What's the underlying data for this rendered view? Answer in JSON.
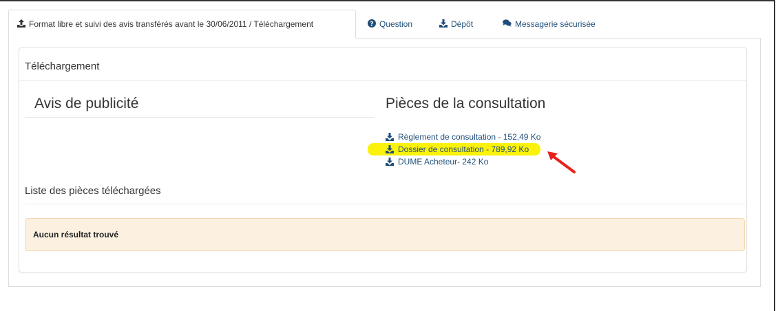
{
  "tabs": [
    {
      "label": "Format libre et suivi des avis transférés avant le 30/06/2011 / Téléchargement",
      "icon": "upload-icon",
      "active": true
    },
    {
      "label": "Question",
      "icon": "question-circle-icon",
      "active": false
    },
    {
      "label": "Dépôt",
      "icon": "download-icon",
      "active": false
    },
    {
      "label": "Messagerie sécurisée",
      "icon": "comments-icon",
      "active": false
    }
  ],
  "panel": {
    "title": "Téléchargement",
    "avis": {
      "title": "Avis de publicité"
    },
    "pieces": {
      "title": "Pièces de la consultation",
      "files": [
        {
          "label": "Règlement de consultation - 152,49 Ko",
          "icon": "download-icon"
        },
        {
          "label": "Dossier de consultation - 789,92 Ko",
          "icon": "download-icon",
          "highlighted": true
        },
        {
          "label": "DUME Acheteur- 242 Ko",
          "icon": "download-icon"
        }
      ]
    },
    "list": {
      "title": "Liste des pièces téléchargées",
      "empty_message": "Aucun résultat trouvé"
    }
  },
  "colors": {
    "link": "#1f4e79",
    "highlight": "#fbf20b",
    "annotation_arrow": "#e8201a",
    "alert_background": "#fcf1e1"
  }
}
